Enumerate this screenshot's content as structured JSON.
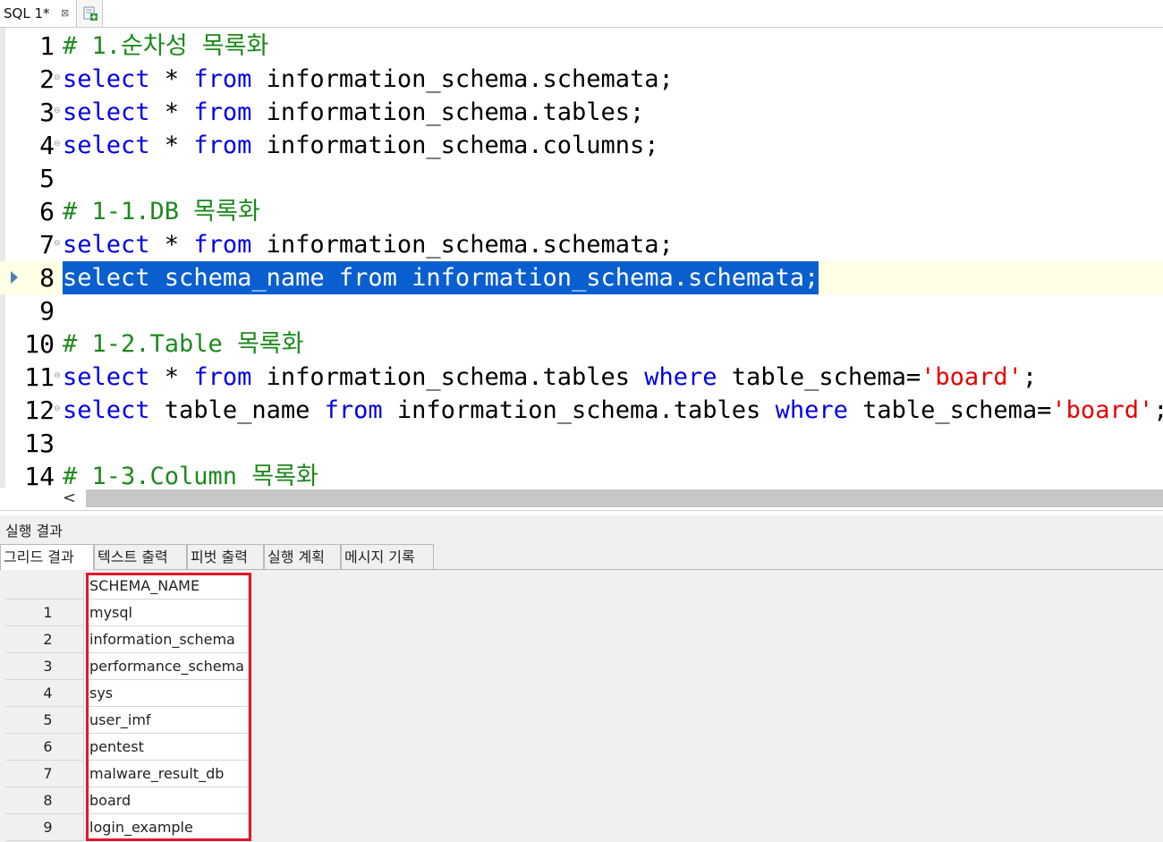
{
  "tab": {
    "label": "SQL 1*",
    "close_glyph": "⊠"
  },
  "editor": {
    "lines": [
      {
        "num": "1",
        "tokens": [
          [
            "c",
            "# 1.순차성 목록화"
          ]
        ]
      },
      {
        "num": "2",
        "tokens": [
          [
            "k",
            "select"
          ],
          [
            "",
            " * "
          ],
          [
            "k",
            "from"
          ],
          [
            "",
            " information_schema.schemata;"
          ]
        ]
      },
      {
        "num": "3",
        "tokens": [
          [
            "k",
            "select"
          ],
          [
            "",
            " * "
          ],
          [
            "k",
            "from"
          ],
          [
            "",
            " information_schema.tables;"
          ]
        ]
      },
      {
        "num": "4",
        "tokens": [
          [
            "k",
            "select"
          ],
          [
            "",
            " * "
          ],
          [
            "k",
            "from"
          ],
          [
            "",
            " information_schema.columns;"
          ]
        ]
      },
      {
        "num": "5",
        "tokens": []
      },
      {
        "num": "6",
        "tokens": [
          [
            "c",
            "# 1-1.DB 목록화"
          ]
        ]
      },
      {
        "num": "7",
        "tokens": [
          [
            "k",
            "select"
          ],
          [
            "",
            " * "
          ],
          [
            "k",
            "from"
          ],
          [
            "",
            " information_schema.schemata;"
          ]
        ]
      },
      {
        "num": "8",
        "tokens": [
          [
            "k",
            "select"
          ],
          [
            "",
            " schema_name "
          ],
          [
            "k",
            "from"
          ],
          [
            "",
            " information_schema.schemata;"
          ]
        ],
        "current": true
      },
      {
        "num": "9",
        "tokens": []
      },
      {
        "num": "10",
        "tokens": [
          [
            "c",
            "# 1-2.Table 목록화"
          ]
        ]
      },
      {
        "num": "11",
        "tokens": [
          [
            "k",
            "select"
          ],
          [
            "",
            " * "
          ],
          [
            "k",
            "from"
          ],
          [
            "",
            " information_schema.tables "
          ],
          [
            "k",
            "where"
          ],
          [
            "",
            " table_schema="
          ],
          [
            "s",
            "'board'"
          ],
          [
            "",
            ";"
          ]
        ]
      },
      {
        "num": "12",
        "tokens": [
          [
            "k",
            "select"
          ],
          [
            "",
            " table_name "
          ],
          [
            "k",
            "from"
          ],
          [
            "",
            " information_schema.tables "
          ],
          [
            "k",
            "where"
          ],
          [
            "",
            " table_schema="
          ],
          [
            "s",
            "'board'"
          ],
          [
            "",
            ";"
          ]
        ]
      },
      {
        "num": "13",
        "tokens": []
      },
      {
        "num": "14",
        "tokens": [
          [
            "c",
            "# 1-3.Column 목록화"
          ]
        ]
      }
    ],
    "fold_lines": [
      "2",
      "3",
      "4",
      "7",
      "11",
      "12"
    ],
    "colors": {
      "comment": "#1d8a1d",
      "keyword": "#0000e6",
      "string": "#e60000",
      "selection": "#0a5fd0"
    }
  },
  "scrollbar": {
    "left_arrow": "<"
  },
  "results": {
    "title": "실행 결과",
    "tabs": [
      "그리드 결과",
      "텍스트 출력",
      "피벗 출력",
      "실행 계획",
      "메시지 기록"
    ],
    "active_tab": 0,
    "column_header": "SCHEMA_NAME",
    "rows": [
      {
        "n": "1",
        "v": "mysql"
      },
      {
        "n": "2",
        "v": "information_schema"
      },
      {
        "n": "3",
        "v": "performance_schema"
      },
      {
        "n": "4",
        "v": "sys"
      },
      {
        "n": "5",
        "v": "user_imf"
      },
      {
        "n": "6",
        "v": "pentest"
      },
      {
        "n": "7",
        "v": "malware_result_db"
      },
      {
        "n": "8",
        "v": "board"
      },
      {
        "n": "9",
        "v": "login_example"
      }
    ],
    "highlight_color": "#e0182a"
  }
}
